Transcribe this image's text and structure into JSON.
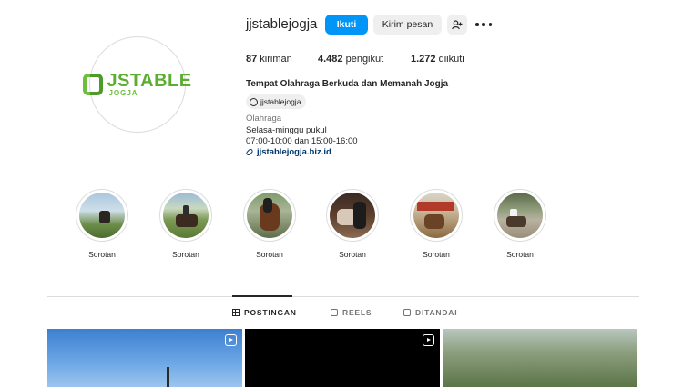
{
  "profile": {
    "username": "jjstablejogja",
    "logo_text": "JSTABLE",
    "logo_sub": "JOGJA",
    "follow_label": "Ikuti",
    "message_label": "Kirim pesan",
    "add_user_icon": "add-user-icon",
    "more_icon": "more-horizontal-icon"
  },
  "stats": {
    "posts_count": "87",
    "posts_label": " kiriman",
    "followers_count": "4.482",
    "followers_label": " pengikut",
    "following_count": "1.272",
    "following_label": " diikuti"
  },
  "bio": {
    "name": "Tempat Olahraga Berkuda dan Memanah Jogja",
    "threads_handle": "jjstablejogja",
    "category": "Olahraga",
    "line1": "Selasa-minggu pukul",
    "line2": "07:00-10:00 dan 15:00-16:00",
    "link": "jjstablejogja.biz.id"
  },
  "highlights": [
    {
      "label": "Sorotan"
    },
    {
      "label": "Sorotan"
    },
    {
      "label": "Sorotan"
    },
    {
      "label": "Sorotan"
    },
    {
      "label": "Sorotan"
    },
    {
      "label": "Sorotan"
    }
  ],
  "tabs": [
    {
      "label": "POSTINGAN",
      "icon": "grid-icon",
      "active": true
    },
    {
      "label": "REELS",
      "icon": "reels-icon",
      "active": false
    },
    {
      "label": "DITANDAI",
      "icon": "tagged-icon",
      "active": false
    }
  ],
  "colors": {
    "accent": "#0095f6",
    "link": "#00376b",
    "logo_green": "#5cad32"
  }
}
